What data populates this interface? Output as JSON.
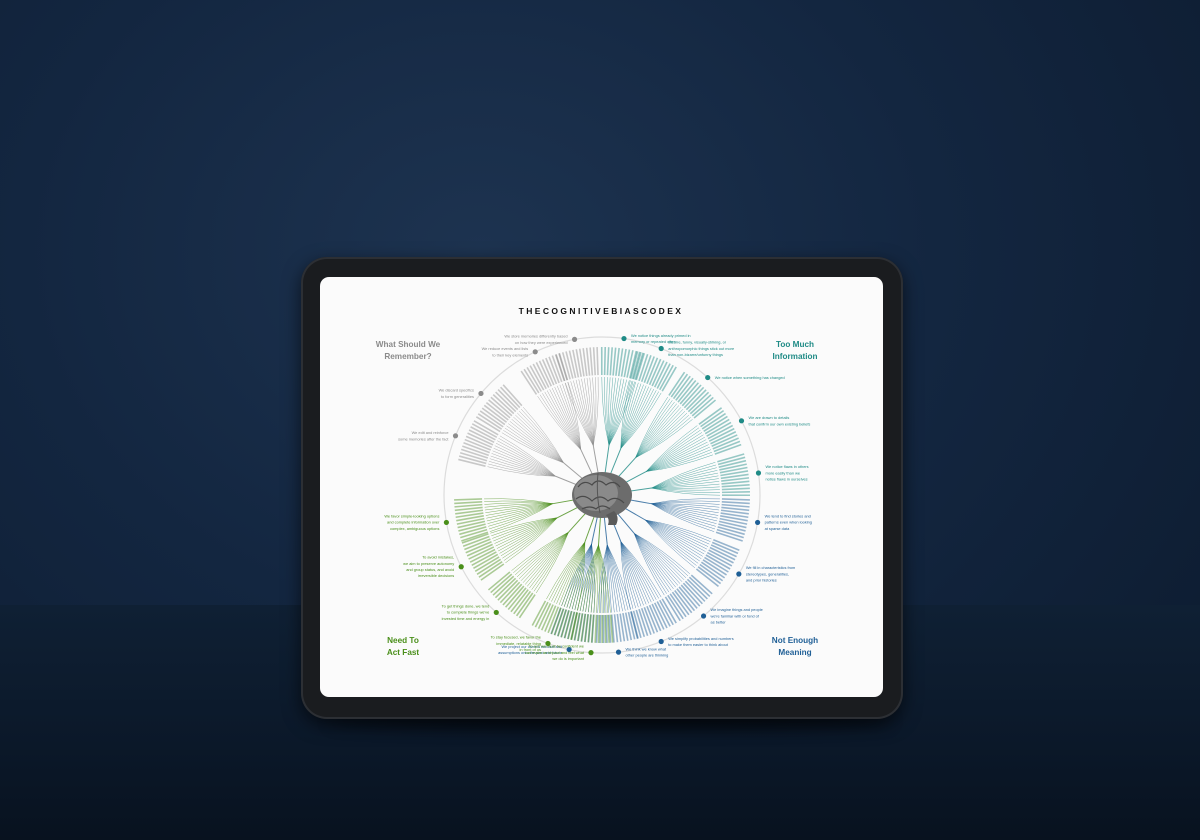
{
  "doc_title": "THECOGNITIVEBIASCODEX",
  "quadrants": [
    {
      "id": "remember",
      "line1": "What Should We",
      "line2": "Remember?",
      "color": "#8b8b8b"
    },
    {
      "id": "info",
      "line1": "Too Much",
      "line2": "Information",
      "color": "#1f8b86"
    },
    {
      "id": "meaning",
      "line1": "Not Enough",
      "line2": "Meaning",
      "color": "#1f5f96"
    },
    {
      "id": "act",
      "line1": "Need To",
      "line2": "Act Fast",
      "color": "#4a8f1a"
    }
  ],
  "categories": {
    "remember": [
      {
        "line1": "We store memories differently based",
        "line2": "on how they were experienced"
      },
      {
        "line1": "We reduce events and lists",
        "line2": "to their key elements"
      },
      {
        "line1": "We discard specifics",
        "line2": "to form generalities"
      },
      {
        "line1": "We edit and reinforce",
        "line2": "some memories after the fact"
      }
    ],
    "info": [
      {
        "line1": "We notice things already primed in",
        "line2": "memory or repeated often"
      },
      {
        "line1": "Bizarre, funny, visually-striking, or",
        "line2": "anthropomorphic things stick out more",
        "line3": "than non-bizarre/unfunny things"
      },
      {
        "line1": "We notice when something has changed"
      },
      {
        "line1": "We are drawn to details",
        "line2": "that confirm our own existing beliefs"
      },
      {
        "line1": "We notice flaws in others",
        "line2": "more easily than we",
        "line3": "notice flaws in ourselves"
      }
    ],
    "meaning": [
      {
        "line1": "We tend to find stories and",
        "line2": "patterns even when looking",
        "line3": "at sparse data"
      },
      {
        "line1": "We fill in characteristics from",
        "line2": "stereotypes, generalities,",
        "line3": "and prior histories"
      },
      {
        "line1": "We imagine things and people",
        "line2": "we're familiar with or fond of",
        "line3": "as better"
      },
      {
        "line1": "We simplify probabilities and numbers",
        "line2": "to make them easier to think about"
      },
      {
        "line1": "We think we know what",
        "line2": "other people are thinking"
      },
      {
        "line1": "We project our current mindset and",
        "line2": "assumptions onto the past and future"
      }
    ],
    "act": [
      {
        "line1": "We favor simple-looking options",
        "line2": "and complete information over",
        "line3": "complex, ambiguous options"
      },
      {
        "line1": "To avoid mistakes,",
        "line2": "we aim to preserve autonomy",
        "line3": "and group status, and avoid",
        "line4": "irreversible decisions"
      },
      {
        "line1": "To get things done, we tend",
        "line2": "to complete things we've",
        "line3": "invested time and energy in"
      },
      {
        "line1": "To stay focused, we favor the",
        "line2": "immediate, relatable thing",
        "line3": "in front of us"
      },
      {
        "line1": "To act, we must be confident we",
        "line2": "can make an impact and feel what",
        "line3": "we do is important"
      }
    ]
  },
  "colors": {
    "remember": "#8b8b8b",
    "info": "#1f8b86",
    "meaning": "#1f5f96",
    "act": "#4a8f1a",
    "ring": "#d9d9d9",
    "title": "#111111"
  },
  "icons": {
    "center": "brain-icon"
  }
}
